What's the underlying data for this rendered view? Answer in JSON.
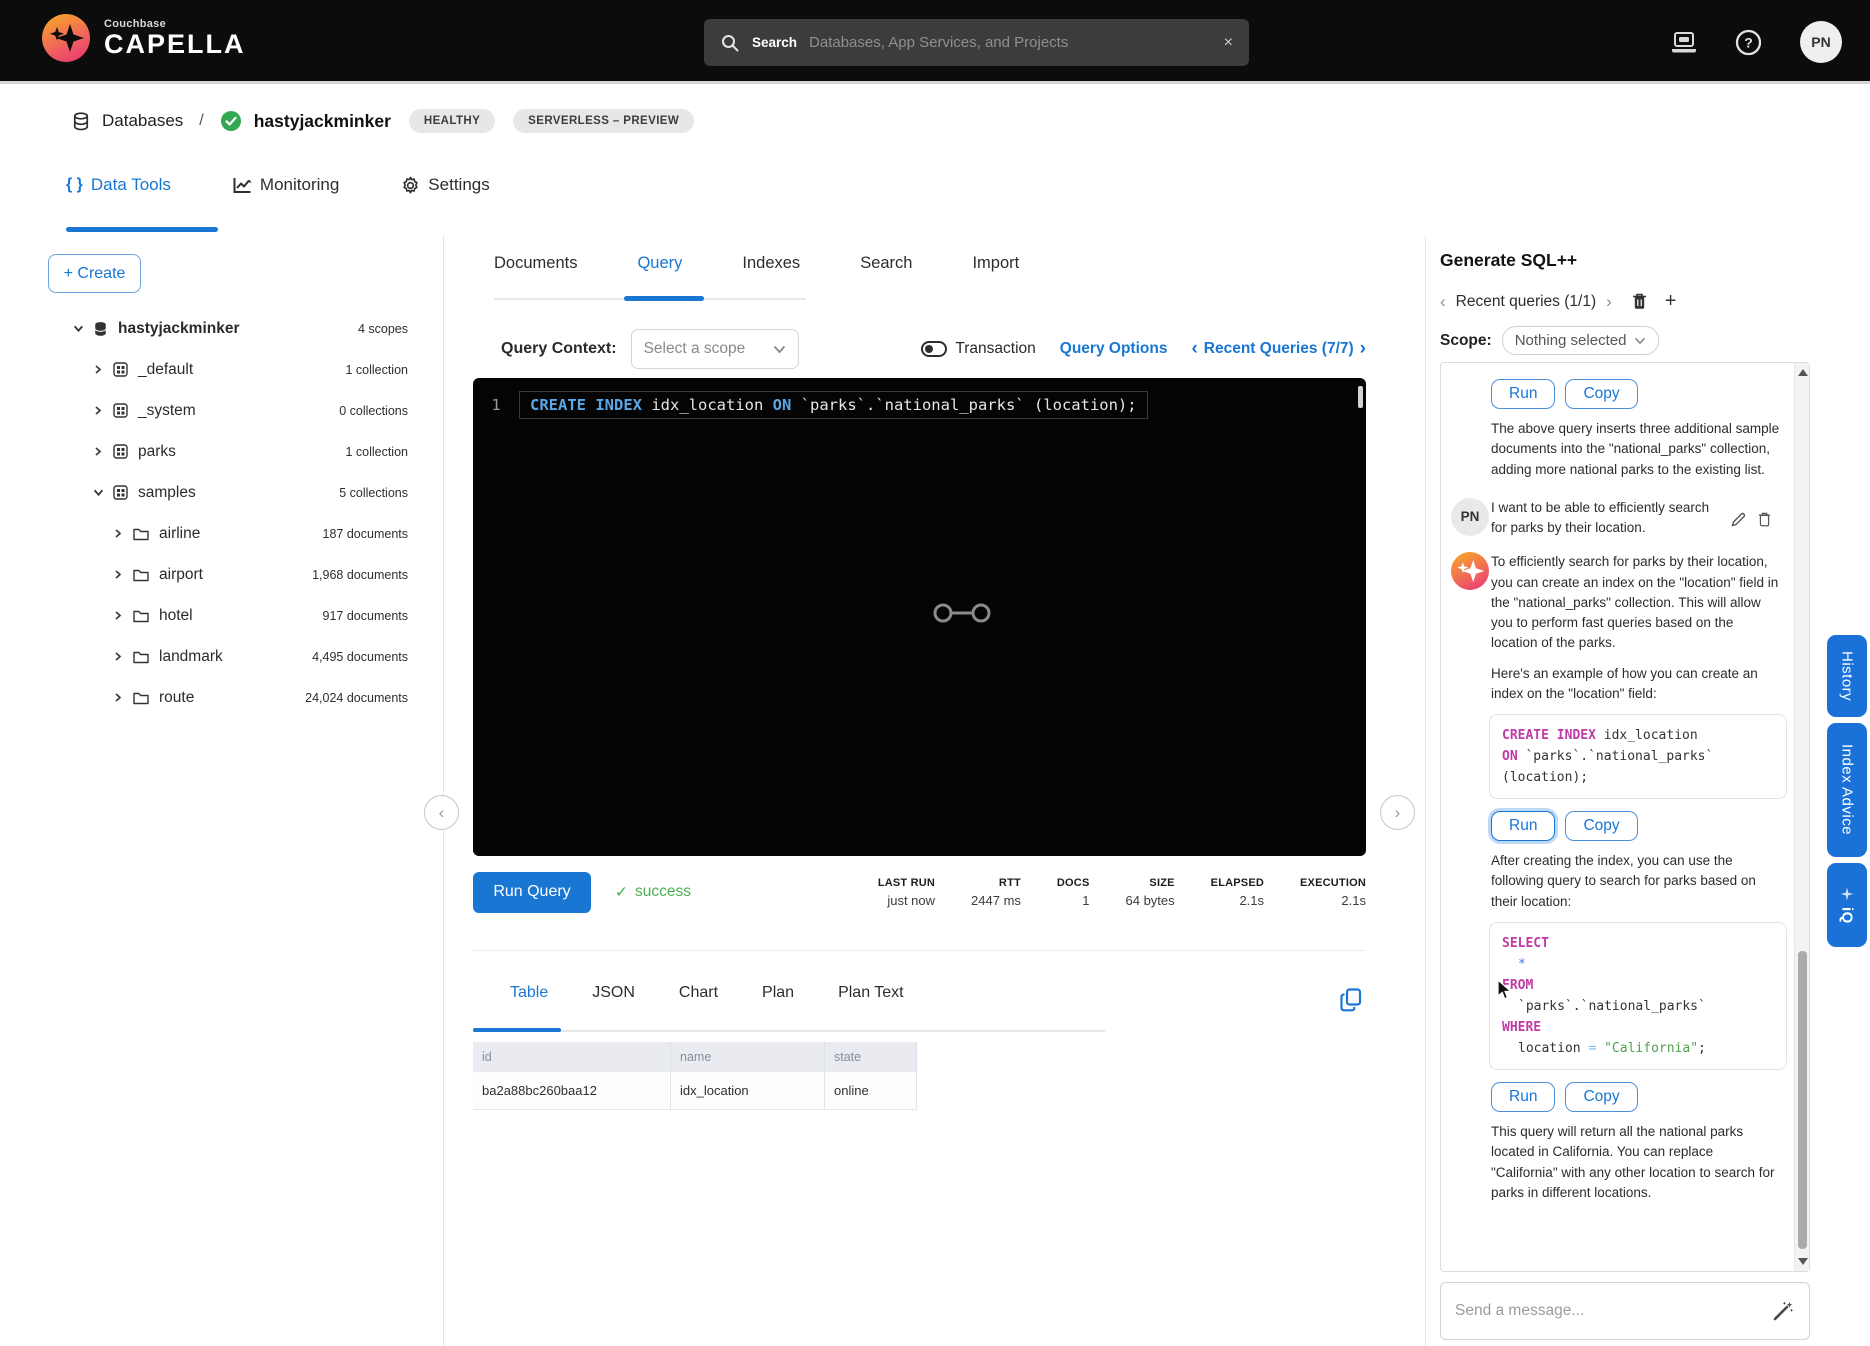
{
  "colors": {
    "accent": "#1976d2",
    "success": "#4caf50",
    "editor_keyword": "#5aa7e8",
    "code_keyword": "#c13ba6",
    "code_string": "#50a14f",
    "topbar_bg": "#0c0c0c"
  },
  "icons": {
    "chevron_left": "‹",
    "chevron_right": "›",
    "plus": "+",
    "close": "×",
    "check": "✓",
    "braces": "{ }",
    "gear": "⚙"
  },
  "topbar": {
    "brand_top": "Couchbase",
    "brand_main": "CAPELLA",
    "search_label": "Search",
    "search_placeholder": "Databases, App Services, and Projects",
    "avatar_initials": "PN"
  },
  "breadcrumb": {
    "root": "Databases",
    "sep": "/",
    "cluster": "hastyjackminker",
    "badge_health": "HEALTHY",
    "badge_type": "SERVERLESS – PREVIEW"
  },
  "nav_tabs": [
    "Data Tools",
    "Monitoring",
    "Settings"
  ],
  "sidebar": {
    "create": "+ Create",
    "tree": [
      {
        "label": "hastyjackminker",
        "count": "4 scopes"
      },
      {
        "label": "_default",
        "count": "1 collection"
      },
      {
        "label": "_system",
        "count": "0 collections"
      },
      {
        "label": "parks",
        "count": "1 collection"
      },
      {
        "label": "samples",
        "count": "5 collections"
      },
      {
        "label": "airline",
        "count": "187 documents"
      },
      {
        "label": "airport",
        "count": "1,968 documents"
      },
      {
        "label": "hotel",
        "count": "917 documents"
      },
      {
        "label": "landmark",
        "count": "4,495 documents"
      },
      {
        "label": "route",
        "count": "24,024 documents"
      }
    ]
  },
  "main": {
    "tabs": [
      "Documents",
      "Query",
      "Indexes",
      "Search",
      "Import"
    ],
    "context": {
      "label": "Query Context:",
      "scope_placeholder": "Select a scope",
      "transaction": "Transaction",
      "options": "Query Options",
      "recent": "Recent Queries (7/7)"
    },
    "editor": {
      "line_no": "1",
      "k1": "CREATE INDEX ",
      "i1": "idx_location ",
      "k2": "ON ",
      "rest": "`parks`.`national_parks` (location);"
    },
    "runbar": {
      "run": "Run Query",
      "status": "success",
      "stats": [
        {
          "label": "LAST RUN",
          "value": "just now"
        },
        {
          "label": "RTT",
          "value": "2447 ms"
        },
        {
          "label": "DOCS",
          "value": "1"
        },
        {
          "label": "SIZE",
          "value": "64 bytes"
        },
        {
          "label": "ELAPSED",
          "value": "2.1s"
        },
        {
          "label": "EXECUTION",
          "value": "2.1s"
        }
      ]
    },
    "result_tabs": [
      "Table",
      "JSON",
      "Chart",
      "Plan",
      "Plan Text"
    ],
    "table": {
      "headers": [
        "id",
        "name",
        "state"
      ],
      "row": [
        "ba2a88bc260baa12",
        "idx_location",
        "online"
      ]
    }
  },
  "panel": {
    "title": "Generate SQL++",
    "recent": "Recent queries (1/1)",
    "scope_label": "Scope:",
    "scope_value": "Nothing selected",
    "run": "Run",
    "copy": "Copy",
    "p_insert": "The above query inserts three additional sample documents into the \"national_parks\" collection, adding more national parks to the existing list.",
    "user_initials": "PN",
    "user_msg": "I want to be able to efficiently search for parks by their location.",
    "p_loc1": "To efficiently search for parks by their location, you can create an index on the \"location\" field in the \"national_parks\" collection. This will allow you to perform fast queries based on the location of the parks.",
    "p_loc2": "Here's an example of how you can create an index on the \"location\" field:",
    "code1": {
      "k1": "CREATE INDEX",
      "p1": " idx_location",
      "k2": "ON",
      "p2": " `parks`.`national_parks`",
      "p3": "(location);"
    },
    "p_after": "After creating the index, you can use the following query to search for parks based on their location:",
    "code2": {
      "k1": "SELECT",
      "star": "*",
      "k2": "FROM",
      "id1": "`parks`.`national_parks`",
      "k3": "WHERE",
      "p1": "location ",
      "op": "=",
      "str": " \"California\"",
      "semi": ";"
    },
    "p_final": "This query will return all the national parks located in California. You can replace \"California\" with any other location to search for parks in different locations.",
    "input_placeholder": "Send a message..."
  },
  "side_tabs": [
    "History",
    "Index Advice",
    "iQ"
  ]
}
